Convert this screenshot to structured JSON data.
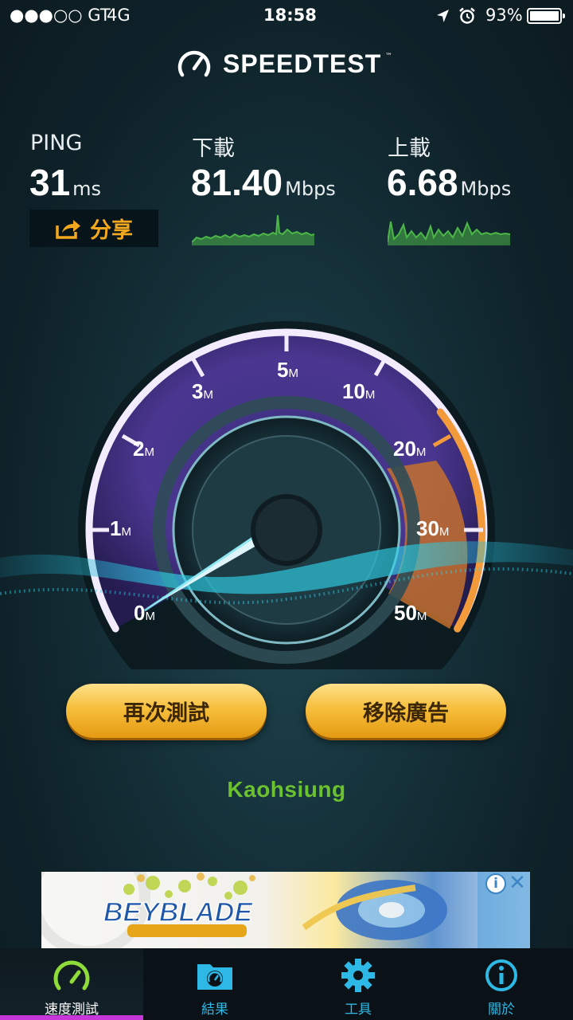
{
  "status_bar": {
    "carrier": "●●●○○ GT",
    "network": "4G",
    "time": "18:58",
    "battery": "93%"
  },
  "header": {
    "title": "SPEEDTEST",
    "trademark": "™"
  },
  "stats": {
    "ping": {
      "label": "PING",
      "value": "31",
      "unit": "ms"
    },
    "download": {
      "label": "下載",
      "value": "81.40",
      "unit": "Mbps"
    },
    "upload": {
      "label": "上載",
      "value": "6.68",
      "unit": "Mbps"
    },
    "share_label": "分享"
  },
  "gauge": {
    "ticks": [
      {
        "num": "0",
        "unit": "M"
      },
      {
        "num": "1",
        "unit": "M"
      },
      {
        "num": "2",
        "unit": "M"
      },
      {
        "num": "3",
        "unit": "M"
      },
      {
        "num": "5",
        "unit": "M"
      },
      {
        "num": "10",
        "unit": "M"
      },
      {
        "num": "20",
        "unit": "M"
      },
      {
        "num": "30",
        "unit": "M"
      },
      {
        "num": "50",
        "unit": "M"
      }
    ]
  },
  "buttons": {
    "retest": "再次測試",
    "remove_ads": "移除廣告"
  },
  "server": {
    "location": "Kaohsiung"
  },
  "ad": {
    "brand": "BEYBLADE",
    "info": "i",
    "close": "✕"
  },
  "nav": {
    "items": [
      {
        "label": "速度測試",
        "icon": "speedometer-icon"
      },
      {
        "label": "結果",
        "icon": "results-folder-icon"
      },
      {
        "label": "工具",
        "icon": "gear-icon"
      },
      {
        "label": "關於",
        "icon": "info-icon"
      }
    ]
  },
  "colors": {
    "accent_orange": "#f4a81d",
    "nav_blue": "#2db8e6",
    "nav_active_underline": "#c636d8",
    "server_green": "#6cc130",
    "gauge_purple": "#5b3f9c",
    "gauge_orange": "#f08a2c"
  }
}
